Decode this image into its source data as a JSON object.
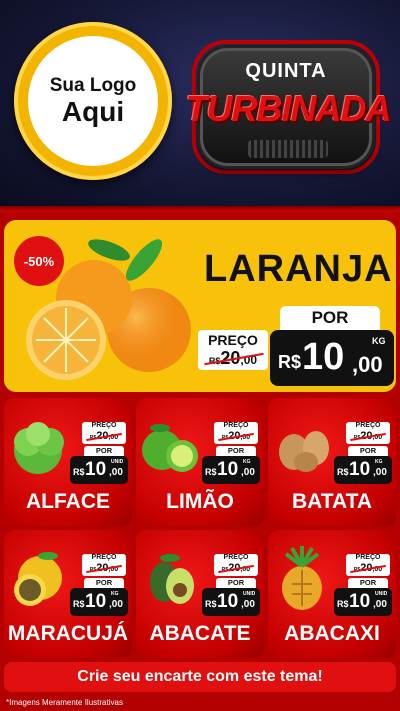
{
  "header": {
    "logo": {
      "line1": "Sua Logo",
      "line2": "Aqui"
    },
    "title_small": "QUINTA",
    "title_big": "TURBINADA"
  },
  "featured": {
    "discount": "-50%",
    "name": "LARANJA",
    "price_label": "PREÇO",
    "old_price": {
      "currency": "R$",
      "int": "20",
      "cents": ",00"
    },
    "por_label": "POR",
    "new_price": {
      "currency": "R$",
      "int": "10",
      "cents": ",00",
      "unit": "KG"
    }
  },
  "products": [
    {
      "name": "ALFACE",
      "price_label": "PREÇO",
      "old_currency": "R$",
      "old_int": "20",
      "old_cents": ",00",
      "por_label": "POR",
      "currency": "R$",
      "int": "10",
      "cents": ",00",
      "unit": "UNID"
    },
    {
      "name": "LIMÃO",
      "price_label": "PREÇO",
      "old_currency": "R$",
      "old_int": "20",
      "old_cents": ",00",
      "por_label": "POR",
      "currency": "R$",
      "int": "10",
      "cents": ",00",
      "unit": "KG"
    },
    {
      "name": "BATATA",
      "price_label": "PREÇO",
      "old_currency": "R$",
      "old_int": "20",
      "old_cents": ",00",
      "por_label": "POR",
      "currency": "R$",
      "int": "10",
      "cents": ",00",
      "unit": "KG"
    },
    {
      "name": "MARACUJÁ",
      "price_label": "PREÇO",
      "old_currency": "R$",
      "old_int": "20",
      "old_cents": ",00",
      "por_label": "POR",
      "currency": "R$",
      "int": "10",
      "cents": ",00",
      "unit": "KG"
    },
    {
      "name": "ABACATE",
      "price_label": "PREÇO",
      "old_currency": "R$",
      "old_int": "20",
      "old_cents": ",00",
      "por_label": "POR",
      "currency": "R$",
      "int": "10",
      "cents": ",00",
      "unit": "UNID"
    },
    {
      "name": "ABACAXI",
      "price_label": "PREÇO",
      "old_currency": "R$",
      "old_int": "20",
      "old_cents": ",00",
      "por_label": "POR",
      "currency": "R$",
      "int": "10",
      "cents": ",00",
      "unit": "UNID"
    }
  ],
  "footer": {
    "cta": "Crie seu encarte com este tema!",
    "disclaimer": "*Imagens Meramente Ilustrativas"
  },
  "colors": {
    "brand_red": "#e01010",
    "featured_yellow": "#f8c20a",
    "header_navy": "#151735"
  }
}
